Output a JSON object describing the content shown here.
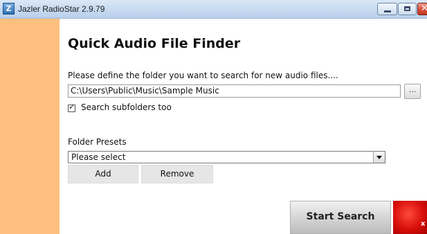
{
  "window": {
    "title": "Jazler RadioStar 2.9.79",
    "app_icon_text": "Z",
    "minimize_icon": "minimize-icon",
    "maximize_icon": "maximize-icon",
    "close_icon": "close-icon",
    "close_glyph": "✕"
  },
  "colors": {
    "sidebar": "#ffbf7f",
    "exit_button": "#d80f0c"
  },
  "main": {
    "title": "Quick Audio File Finder",
    "instruction": "Please define the folder you want to search for new audio files....",
    "folder_path": "C:\\Users\\Public\\Music\\Sample Music",
    "browse_label": "...",
    "include_subfolders": {
      "label": "Search subfolders too",
      "checked": true,
      "tick": "✓"
    },
    "presets_label": "Folder Presets",
    "presets_selected": "Please select",
    "add_label": "Add",
    "remove_label": "Remove",
    "start_label": "Start Search",
    "exit_label": "x"
  }
}
